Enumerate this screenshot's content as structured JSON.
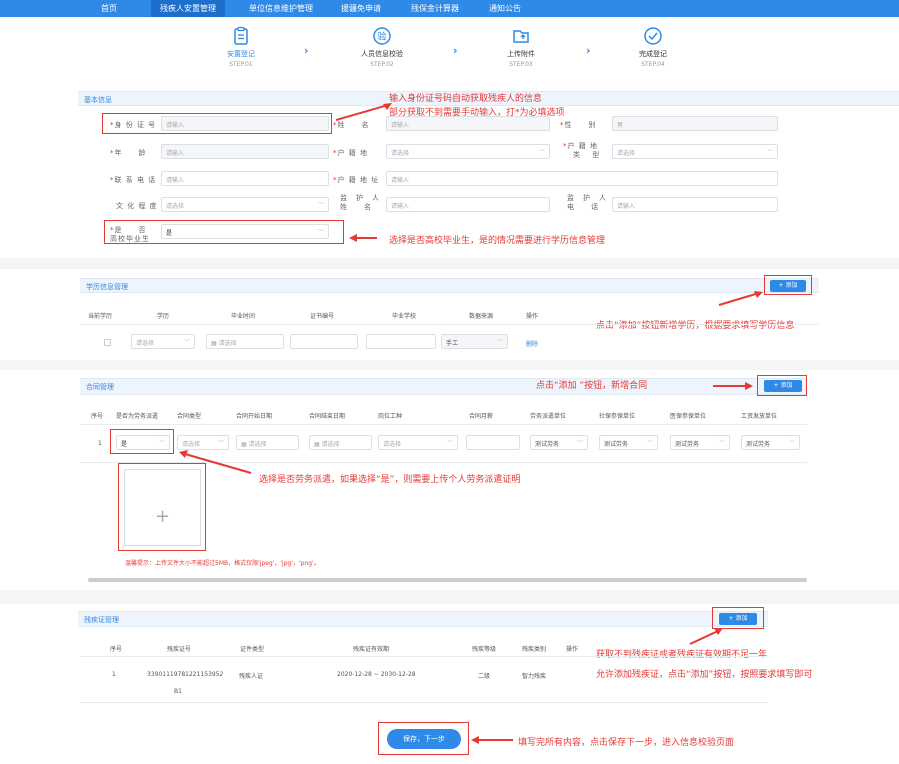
{
  "nav": {
    "items": [
      "首页",
      "残疾人安置管理",
      "单位信息维护管理",
      "援疆免申请",
      "残保金计算器",
      "通知公告"
    ]
  },
  "steps": [
    {
      "title": "安置登记",
      "sub": "STEP.01"
    },
    {
      "title": "人员信息校验",
      "sub": "STEP.02"
    },
    {
      "title": "上传附件",
      "sub": "STEP.03"
    },
    {
      "title": "完成登记",
      "sub": "STEP.04"
    }
  ],
  "basic": {
    "section_title": "基本信息",
    "id_label": "身 份 证 号",
    "id_placeholder": "请输入",
    "name_label": "姓　　名",
    "name_placeholder": "请输入",
    "gender_label": "性　　别",
    "gender_value": "男",
    "age_label": "年　　龄",
    "age_placeholder": "请输入",
    "household_label": "户 籍 地",
    "household_placeholder": "请选择",
    "household_type_label_1": "户 籍 地",
    "household_type_label_2": "类　 型",
    "household_type_placeholder": "请选择",
    "phone_label": "联 系 电 话",
    "phone_placeholder": "请输入",
    "address_label": "户 籍 地 址",
    "address_placeholder": "请输入",
    "edu_label": "文 化 程 度",
    "edu_placeholder": "请选择",
    "guardian_label_1": "监　护　人",
    "guardian_label_2": "姓　　名",
    "guardian_placeholder": "请输入",
    "guardian_phone_label_1": "监　护　人",
    "guardian_phone_label_2": "电　　话",
    "guardian_phone_placeholder": "请输入",
    "grad_label_1": "是　　否",
    "grad_label_2": "高校毕业生",
    "grad_value": "是"
  },
  "annotations": {
    "id_line1": "输入身份证号码自动获取残疾人的信息",
    "id_line2": "部分获取不到需要手动输入，打*为必填选项",
    "grad": "选择是否高校毕业生，是的情况需要进行学历信息管理",
    "edu_add": "点击“添加”按钮新增学历，根据要求填写学历信息",
    "contract_add": "点击“添加 ”按钮，新增合同",
    "dispatch": "选择是否劳务派遣，如果选择“是”，则需要上传个人劳务派遣证明",
    "disab_line1": "获取不到残疾证或者残疾证有效期不足一年",
    "disab_line2": "允许添加残疾证，点击“添加”按钮，按照要求填写即可",
    "save": "填写完所有内容，点击保存下一步，进入信息校验页面"
  },
  "education": {
    "section_title": "学历信息管理",
    "add_label": "+ 添加",
    "headers": [
      "当前学历",
      "学历",
      "毕业时间",
      "证书编号",
      "毕业学校",
      "数据来源",
      "操作"
    ],
    "row": {
      "edu_placeholder": "请选择",
      "date_placeholder": "请选择",
      "source": "手工",
      "action": "删除"
    }
  },
  "contract": {
    "section_title": "合同管理",
    "add_label": "+ 添加",
    "headers": [
      "序号",
      "是否为劳务派遣",
      "合同类型",
      "合同开始日期",
      "合同结束日期",
      "岗位工种",
      "合同月薪",
      "劳务派遣单位",
      "社保参保单位",
      "医保参保单位",
      "工资发放单位"
    ],
    "row": {
      "index": "1",
      "dispatch": "是",
      "type_placeholder": "请选择",
      "start_placeholder": "请选择",
      "end_placeholder": "请选择",
      "job_placeholder": "请选择",
      "dispatch_unit": "测试劳务",
      "social_unit": "测试劳务",
      "medical_unit": "测试劳务",
      "salary_unit": "测试劳务"
    },
    "upload_plus": "+",
    "hint": "温馨提示：上传文件大小不能超过5MB，格式仅限'jpeg'，'jpg'，'png'。"
  },
  "disability": {
    "section_title": "残疾证管理",
    "add_label": "+ 添加",
    "headers": [
      "序号",
      "残疾证号",
      "证件类型",
      "残疾证有效期",
      "残疾等级",
      "残疾类别",
      "操作"
    ],
    "row": {
      "index": "1",
      "cert_no_1": "33901119781221153952",
      "cert_no_2": "B1",
      "type": "残疾人证",
      "validity": "2020-12-28 ~ 2030-12-28",
      "level": "二级",
      "category": "智力残疾"
    }
  },
  "save_button": "保存，下一步"
}
